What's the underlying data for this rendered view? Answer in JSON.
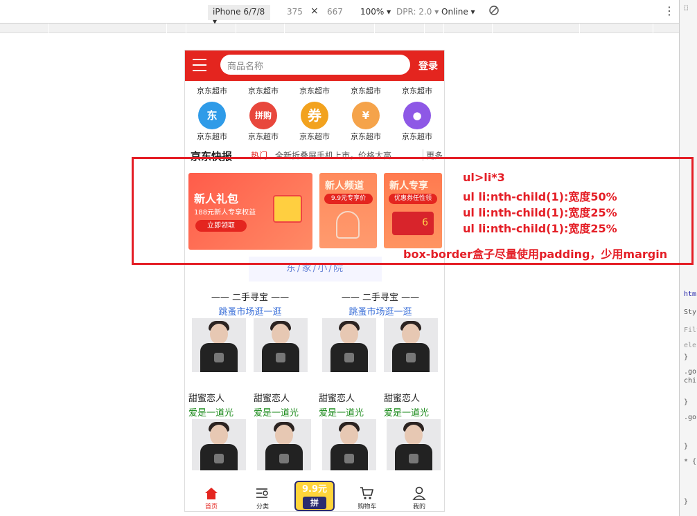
{
  "devtools": {
    "device": "iPhone 6/7/8",
    "width": "375",
    "times": "×",
    "height": "667",
    "zoom": "100%",
    "dpr": "DPR: 2.0",
    "network": "Online",
    "side_lines": [
      "htm",
      "Sty",
      "Filt",
      "ele",
      "}",
      ".go",
      "chi",
      "}",
      ".go",
      "}",
      "* {",
      "}"
    ]
  },
  "header": {
    "search_placeholder": "商品名称",
    "login": "登录"
  },
  "categories": {
    "top_labels": [
      "京东超市",
      "京东超市",
      "京东超市",
      "京东超市",
      "京东超市"
    ],
    "icons": [
      {
        "glyph": "东",
        "color": "#2f9be8"
      },
      {
        "glyph": "拼购",
        "color": "#e8473c"
      },
      {
        "glyph": "券",
        "color": "#f2a21e"
      },
      {
        "glyph": "¥",
        "color": "#f5a34a"
      },
      {
        "glyph": "●",
        "color": "#8e58e6"
      }
    ],
    "bottom_labels": [
      "京东超市",
      "京东超市",
      "京东超市",
      "京东超市",
      "京东超市"
    ]
  },
  "news": {
    "title": "京东快报",
    "tag": "热门",
    "headline": "全新折叠屏手机上市，价格太高",
    "more": "更多"
  },
  "promo": {
    "p1_title": "新人礼包",
    "p1_sub": "188元新人专享权益",
    "p1_button": "立即领取",
    "p2_title": "新人频道",
    "p2_tag": "9.9元专享价",
    "p3_title": "新人专享",
    "p3_tag": "优惠券任性领",
    "p3_coupon": "6"
  },
  "family": "东/家/小/院",
  "secondhand": {
    "title": "—— 二手寻宝 ——",
    "subtitle": "跳蚤市场逛一逛"
  },
  "lovers": [
    {
      "name": "甜蜜恋人",
      "desc": "爱是一道光"
    },
    {
      "name": "甜蜜恋人",
      "desc": "爱是一道光"
    },
    {
      "name": "甜蜜恋人",
      "desc": "爱是一道光"
    },
    {
      "name": "甜蜜恋人",
      "desc": "爱是一道光"
    }
  ],
  "tabbar": {
    "home": "首页",
    "category": "分类",
    "promo_top": "9.9元",
    "promo_bottom": "拼",
    "cart": "购物车",
    "mine": "我的"
  },
  "annotation": {
    "line1": "ul>li*3",
    "line2": "ul li:nth-child(1):宽度50%",
    "line3": "ul li:nth-child(1):宽度25%",
    "line4": "ul li:nth-child(1):宽度25%",
    "line5": "box-border盒子尽量使用padding，少用margin",
    "color": "#e41e26"
  }
}
